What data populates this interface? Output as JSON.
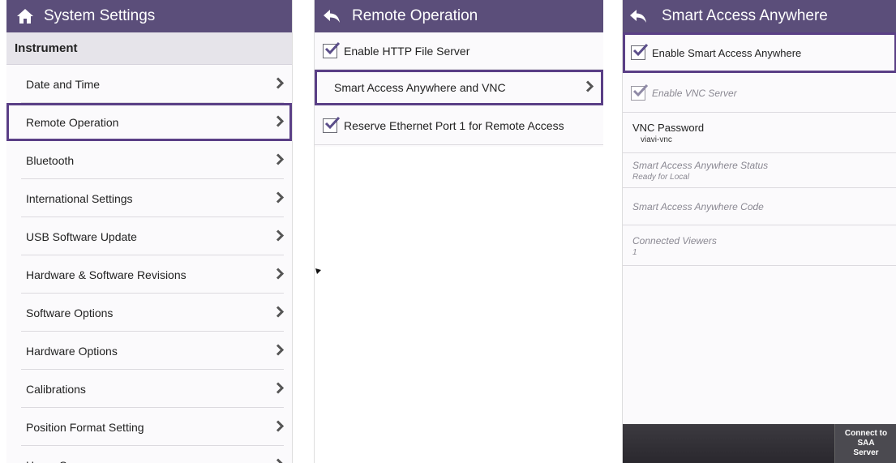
{
  "panel1": {
    "title": "System Settings",
    "section": "Instrument",
    "items": [
      {
        "label": "Date and Time"
      },
      {
        "label": "Remote Operation",
        "selected": true
      },
      {
        "label": "Bluetooth"
      },
      {
        "label": "International Settings"
      },
      {
        "label": "USB Software Update"
      },
      {
        "label": "Hardware & Software Revisions"
      },
      {
        "label": "Software Options"
      },
      {
        "label": "Hardware Options"
      },
      {
        "label": "Calibrations"
      },
      {
        "label": "Position Format Setting"
      },
      {
        "label": "Home Screen"
      }
    ]
  },
  "panel2": {
    "title": "Remote Operation",
    "enable_http_label": "Enable HTTP File Server",
    "enable_http_checked": true,
    "saa_vnc_label": "Smart Access Anywhere and VNC",
    "reserve_label": "Reserve Ethernet Port 1 for Remote Access",
    "reserve_checked": true
  },
  "panel3": {
    "title": "Smart Access Anywhere",
    "enable_saa_label": "Enable Smart Access Anywhere",
    "enable_saa_checked": true,
    "enable_vnc_label": "Enable VNC Server",
    "enable_vnc_checked": true,
    "vnc_password_label": "VNC Password",
    "vnc_password_value": "viavi-vnc",
    "status_label": "Smart Access Anywhere Status",
    "status_value": "Ready for Local",
    "code_label": "Smart Access Anywhere Code",
    "viewers_label": "Connected Viewers",
    "viewers_value": "1",
    "connect_line1": "Connect to SAA",
    "connect_line2": "Server"
  },
  "colors": {
    "titlebar": "#5b4e7a",
    "selection": "#5a3f86",
    "section_bg": "#e6e4ea",
    "check": "#5b4e8a"
  },
  "icons": {
    "home": "home-icon",
    "back": "back-arrow-icon",
    "chevron": "chevron-right-icon",
    "checkbox": "checkbox-checked-icon"
  }
}
